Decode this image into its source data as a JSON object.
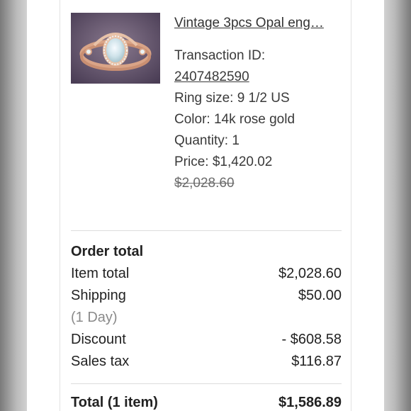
{
  "item": {
    "title": "Vintage 3pcs Opal eng…",
    "image_alt": "opal-ring-set-photo",
    "transaction_label": "Transaction ID:",
    "transaction_id": "2407482590",
    "ring_size": "Ring size: 9 1/2 US",
    "color": "Color: 14k rose gold",
    "quantity": "Quantity: 1",
    "price": "Price: $1,420.02",
    "original_price": "$2,028.60"
  },
  "order_total": {
    "heading": "Order total",
    "rows": [
      {
        "label": "Item total",
        "value": "$2,028.60"
      },
      {
        "label": "Shipping",
        "value": "$50.00",
        "sublabel": "(1 Day)"
      },
      {
        "label": "Discount",
        "value": "- $608.58"
      },
      {
        "label": "Sales tax",
        "value": "$116.87"
      }
    ],
    "total_label": "Total (1 item)",
    "total_value": "$1,586.89"
  }
}
